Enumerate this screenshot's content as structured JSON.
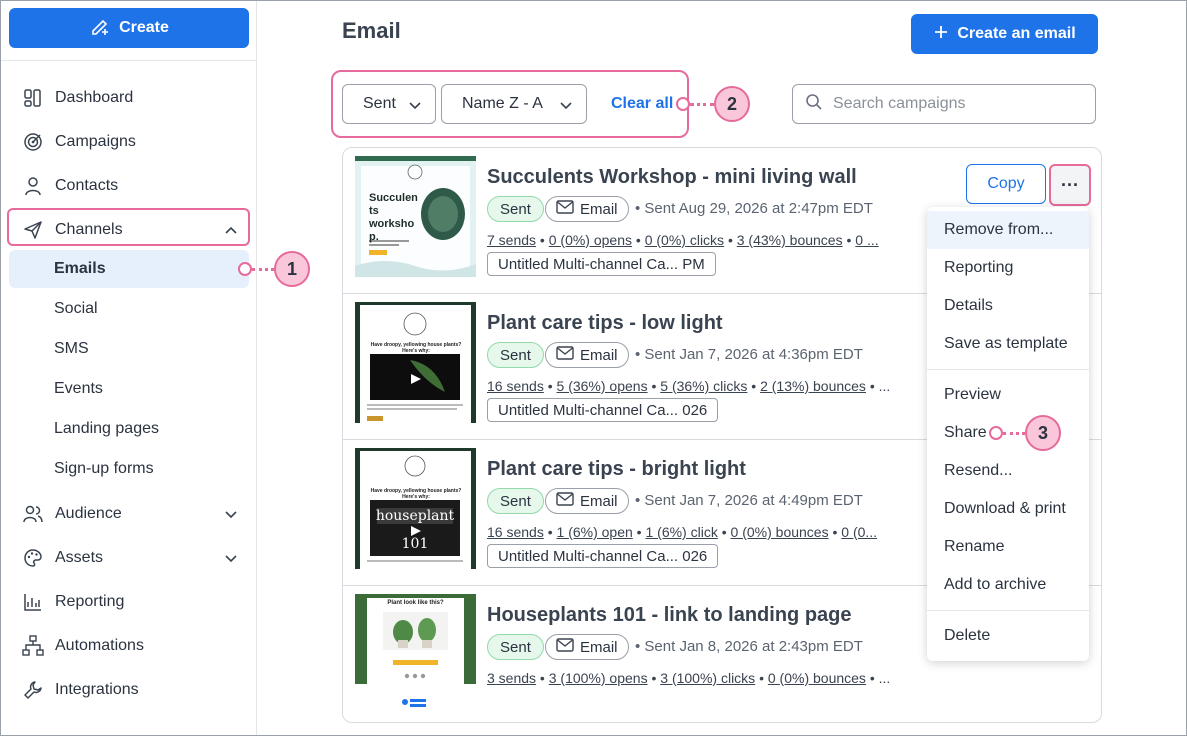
{
  "sidebar": {
    "create_label": "Create",
    "items": [
      {
        "label": "Dashboard",
        "icon": "dashboard-icon"
      },
      {
        "label": "Campaigns",
        "icon": "target-icon"
      },
      {
        "label": "Contacts",
        "icon": "person-icon"
      },
      {
        "label": "Channels",
        "icon": "send-icon"
      },
      {
        "label": "Audience",
        "icon": "people-icon"
      },
      {
        "label": "Assets",
        "icon": "palette-icon"
      },
      {
        "label": "Reporting",
        "icon": "chart-icon"
      },
      {
        "label": "Automations",
        "icon": "flow-icon"
      },
      {
        "label": "Integrations",
        "icon": "wrench-icon"
      }
    ],
    "channels_sub": [
      "Emails",
      "Social",
      "SMS",
      "Events",
      "Landing pages",
      "Sign-up forms"
    ]
  },
  "header": {
    "title": "Email",
    "create_email_label": "Create an email"
  },
  "filters": {
    "status": "Sent",
    "sort": "Name Z - A",
    "clear_all": "Clear all",
    "search_placeholder": "Search campaigns"
  },
  "callouts": [
    "1",
    "2",
    "3"
  ],
  "campaigns": [
    {
      "title": "Succulents Workshop - mini living wall",
      "status": "Sent",
      "type": "Email",
      "sent": "Sent Aug 29, 2026 at 2:47pm EDT",
      "sends": "7 sends",
      "opens": "0 (0%) opens",
      "clicks": "0 (0%) clicks",
      "bounces": "3 (43%) bounces",
      "more": "0 ...",
      "tag": "Untitled Multi-channel Ca... PM",
      "thumb_text": "Succulen ts worksho p."
    },
    {
      "title": "Plant care tips - low light",
      "status": "Sent",
      "type": "Email",
      "sent": "Sent Jan 7, 2026 at 4:36pm EDT",
      "sends": "16 sends",
      "opens": "5 (36%) opens",
      "clicks": "5 (36%) clicks",
      "bounces": "2 (13%) bounces",
      "more": "...",
      "tag": "Untitled Multi-channel Ca... 026",
      "thumb_text": "Have droopy, yellowing house plants? Here's why:"
    },
    {
      "title": "Plant care tips - bright light",
      "status": "Sent",
      "type": "Email",
      "sent": "Sent Jan 7, 2026 at 4:49pm EDT",
      "sends": "16 sends",
      "opens": "1 (6%) open",
      "clicks": "1 (6%) click",
      "bounces": "0 (0%) bounces",
      "more": "0 (0...",
      "tag": "Untitled Multi-channel Ca... 026",
      "thumb_text": "Have droopy, yellowing house plants? Here's why:"
    },
    {
      "title": "Houseplants 101 - link to landing page",
      "status": "Sent",
      "type": "Email",
      "sent": "Sent Jan 8, 2026 at 2:43pm EDT",
      "sends": "3 sends",
      "opens": "3 (100%) opens",
      "clicks": "3 (100%) clicks",
      "bounces": "0 (0%) bounces",
      "more": "...",
      "tag": "",
      "thumb_text": "Plant look like this?"
    }
  ],
  "row_actions": {
    "copy_label": "Copy",
    "more_label": "···"
  },
  "menu": {
    "items": [
      "Remove from...",
      "Reporting",
      "Details",
      "Save as template",
      "Preview",
      "Share",
      "Resend...",
      "Download & print",
      "Rename",
      "Add to archive",
      "Delete"
    ]
  },
  "colors": {
    "accent": "#1f73e8",
    "highlight": "#e76a9c",
    "sent_badge": "#e6f7ec"
  }
}
